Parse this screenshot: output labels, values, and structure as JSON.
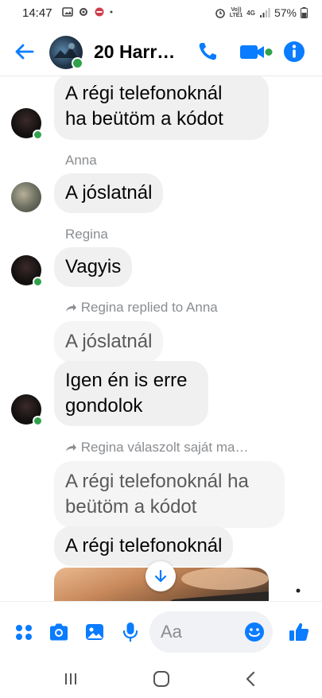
{
  "status_bar": {
    "time": "14:47",
    "volte_top": "Vo))",
    "volte_bottom": "LTE1",
    "network": "4G",
    "battery": "57%"
  },
  "header": {
    "title": "20 Harr…"
  },
  "messages": {
    "m1": {
      "line1": "A régi telefonoknál",
      "line2": "ha beütöm a kódot"
    },
    "anna_name": "Anna",
    "m2": "A jóslatnál",
    "regina_name": "Regina",
    "m3": "Vagyis",
    "reply1_note": "Regina replied to Anna",
    "m4_quote": "A jóslatnál",
    "m4": {
      "line1": "Igen én is erre",
      "line2": "gondolok"
    },
    "reply2_note": "Regina válaszolt saját ma…",
    "m5_quote": {
      "line1": "A régi telefonoknál ha",
      "line2": "beütöm a kódot"
    },
    "m5": "A régi telefonoknál"
  },
  "composer": {
    "placeholder": "Aa"
  },
  "icons": [
    "back-arrow-icon",
    "phone-icon",
    "video-camera-icon",
    "info-icon",
    "apps-icon",
    "camera-icon",
    "gallery-icon",
    "microphone-icon",
    "emoji-icon",
    "thumbs-up-icon",
    "arrow-down-icon",
    "reply-arrow-icon"
  ],
  "colors": {
    "accent": "#0a7cff",
    "online": "#31a24c",
    "bubble": "#f0f0f0",
    "meta_text": "#8a8d91"
  }
}
